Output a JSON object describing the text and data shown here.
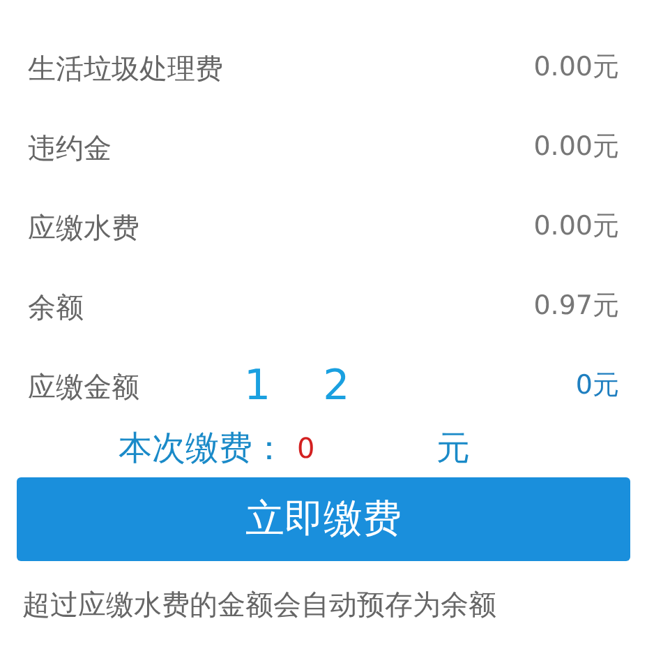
{
  "rows": [
    {
      "label": "生活垃圾处理费",
      "value": "0.00元",
      "highlight": false
    },
    {
      "label": "违约金",
      "value": "0.00元",
      "highlight": false
    },
    {
      "label": "应缴水费",
      "value": "0.00元",
      "highlight": false
    },
    {
      "label": "余额",
      "value": "0.97元",
      "highlight": false
    },
    {
      "label": "应缴金额",
      "value": "0元",
      "highlight": true
    }
  ],
  "annotation": "1 2",
  "payment": {
    "label": "本次缴费：",
    "value": "0",
    "unit": "元"
  },
  "pay_button": "立即缴费",
  "note": "超过应缴水费的金额会自动预存为余额"
}
